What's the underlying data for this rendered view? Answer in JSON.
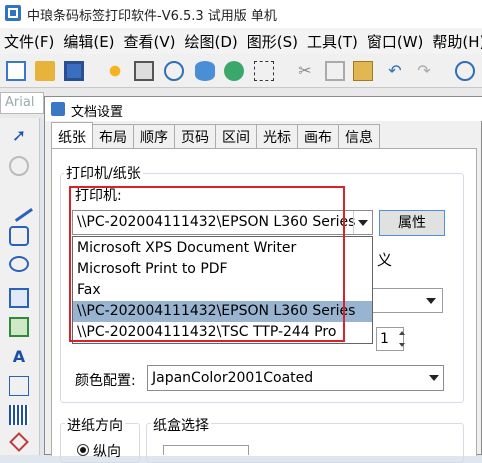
{
  "window": {
    "title": "中琅条码标签打印软件-V6.5.3 试用版 单机"
  },
  "menu": [
    "文件(F)",
    "编辑(E)",
    "查看(V)",
    "绘图(D)",
    "图形(S)",
    "工具(T)",
    "窗口(W)",
    "帮助(H)"
  ],
  "formatbar": {
    "font_name": "Arial"
  },
  "dialog": {
    "title": "文档设置",
    "tabs": [
      "纸张",
      "布局",
      "顺序",
      "页码",
      "区间",
      "光标",
      "画布",
      "信息"
    ],
    "printer_group_label": "打印机/纸张",
    "printer_label": "打印机:",
    "printer_selected": "\\\\PC-202004111432\\EPSON L360 Series",
    "properties_button": "属性",
    "printer_options": [
      "Microsoft XPS Document Writer",
      "Microsoft Print to PDF",
      "Fax",
      "\\\\PC-202004111432\\EPSON L360 Series",
      "\\\\PC-202004111432\\TSC TTP-244 Pro"
    ],
    "selected_index": 3,
    "partial_label": "义",
    "spin_value": "1",
    "color_label": "颜色配置:",
    "color_value": "JapanColor2001Coated",
    "feed_group_label": "进纸方向",
    "portrait_label": "纵向",
    "tray_group_label": "纸盒选择"
  },
  "colors": {
    "highlight": "#99b4d1",
    "annotation_red": "#d8232a",
    "button_border": "#4d8fd9"
  }
}
